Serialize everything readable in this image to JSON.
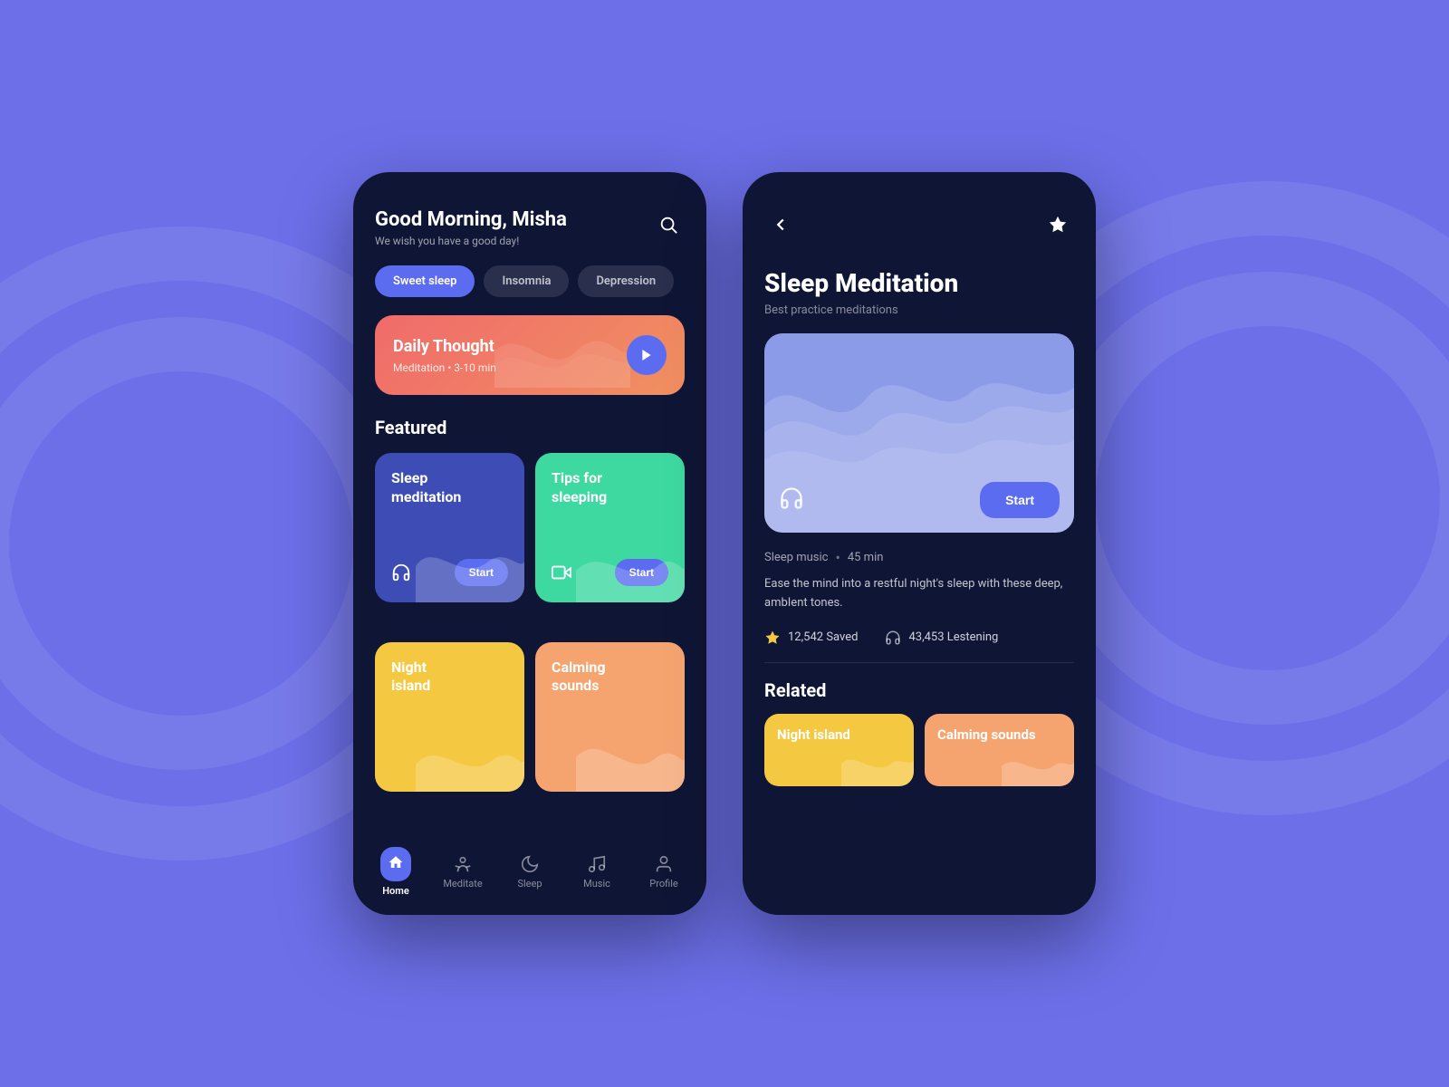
{
  "background": "#6c6fe8",
  "phone1": {
    "greeting": "Good Morning, Misha",
    "greeting_sub": "We wish you have a good day!",
    "filters": [
      {
        "label": "Sweet sleep",
        "active": true
      },
      {
        "label": "Insomnia",
        "active": false
      },
      {
        "label": "Depression",
        "active": false
      }
    ],
    "daily_card": {
      "title": "Daily Thought",
      "subtitle": "Meditation • 3-10 min"
    },
    "featured_title": "Featured",
    "featured_cards": [
      {
        "title": "Sleep meditation",
        "color": "blue",
        "icon": "headphones"
      },
      {
        "title": "Tips for sleeping",
        "color": "green",
        "icon": "video"
      },
      {
        "title": "Night island",
        "color": "yellow",
        "icon": ""
      },
      {
        "title": "Calming sounds",
        "color": "orange",
        "icon": ""
      }
    ],
    "nav_items": [
      {
        "label": "Home",
        "active": true
      },
      {
        "label": "Meditate",
        "active": false
      },
      {
        "label": "Sleep",
        "active": false
      },
      {
        "label": "Music",
        "active": false
      },
      {
        "label": "Profile",
        "active": false
      }
    ]
  },
  "phone2": {
    "title": "Sleep Meditation",
    "subtitle": "Best practice meditations",
    "player": {
      "meta_type": "Sleep music",
      "meta_dot": "•",
      "meta_duration": "45 min",
      "description": "Ease the mind into a restful night's sleep with these deep, ambIent tones.",
      "start_label": "Start"
    },
    "stats": {
      "saved_count": "12,542 Saved",
      "listening_count": "43,453 Lestening"
    },
    "related_title": "Related",
    "related_cards": [
      {
        "title": "Night island",
        "color": "yellow"
      },
      {
        "title": "Calming sounds",
        "color": "orange"
      }
    ]
  }
}
